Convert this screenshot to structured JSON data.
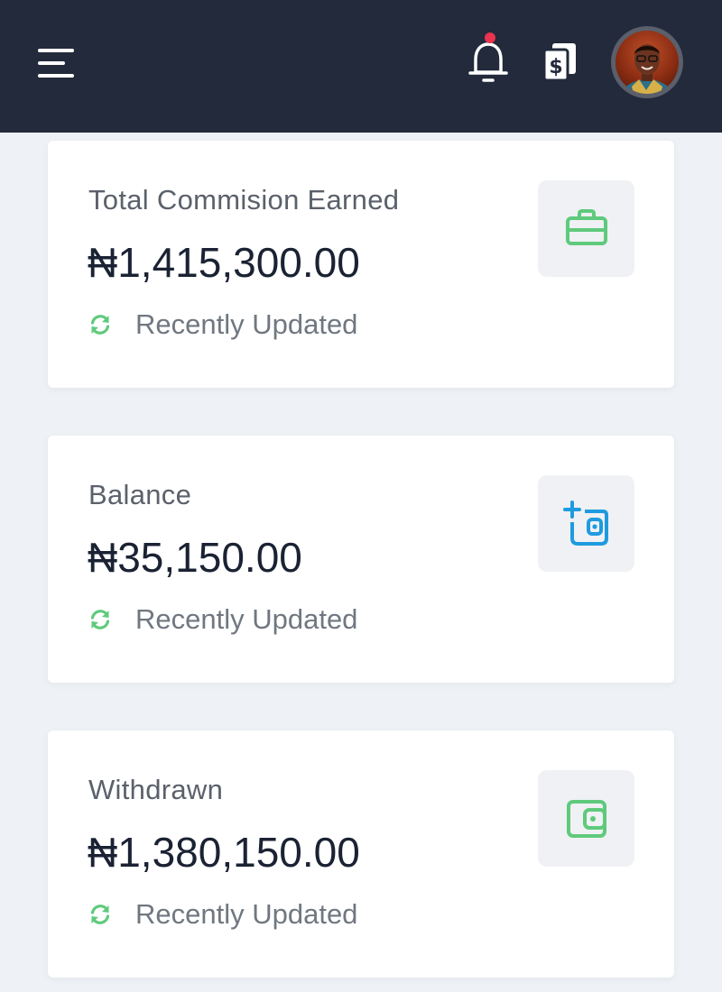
{
  "header": {
    "menu_icon": "hamburger-menu-icon",
    "notification_icon": "bell-icon",
    "notification_dot_color": "#e8344e",
    "wallet_icon": "dollar-bills-icon",
    "background_color": "#222a3b"
  },
  "cards": [
    {
      "title": "Total Commision Earned",
      "amount": "₦1,415,300.00",
      "status": "Recently Updated",
      "icon": "briefcase-icon",
      "icon_color": "#5fca7c"
    },
    {
      "title": "Balance",
      "amount": "₦35,150.00",
      "status": "Recently Updated",
      "icon": "add-wallet-icon",
      "icon_color": "#1e9be0"
    },
    {
      "title": "Withdrawn",
      "amount": "₦1,380,150.00",
      "status": "Recently Updated",
      "icon": "wallet-icon",
      "icon_color": "#5fca7c"
    }
  ],
  "status_icon": "refresh-icon",
  "status_icon_color": "#5fca7c"
}
